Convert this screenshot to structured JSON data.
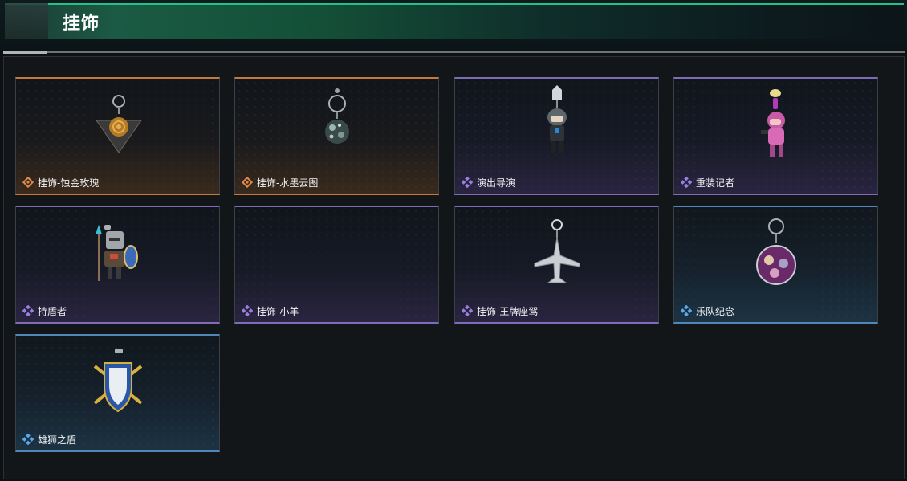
{
  "header": {
    "title": "挂饰"
  },
  "colors": {
    "gold": "#e08a4a",
    "purple": "#9a7ee0",
    "blue": "#5aa8e8",
    "accent_green": "#23c184"
  },
  "items": [
    {
      "label": "挂饰-蚀金玫瑰",
      "rarity": "gold",
      "icon": "rose-keychain-icon"
    },
    {
      "label": "挂饰-水墨云图",
      "rarity": "gold",
      "icon": "ball-keychain-icon"
    },
    {
      "label": "演出导演",
      "rarity": "purple",
      "icon": "soldier-figure-icon"
    },
    {
      "label": "重装记者",
      "rarity": "purple",
      "icon": "pink-figure-icon"
    },
    {
      "label": "持盾者",
      "rarity": "purple",
      "icon": "knight-figure-icon"
    },
    {
      "label": "挂饰-小羊",
      "rarity": "purple",
      "icon": "empty-icon"
    },
    {
      "label": "挂饰-王牌座驾",
      "rarity": "purple",
      "icon": "jet-keychain-icon"
    },
    {
      "label": "乐队纪念",
      "rarity": "blue",
      "icon": "badge-keychain-icon"
    },
    {
      "label": "雄狮之盾",
      "rarity": "blue",
      "icon": "lion-shield-icon"
    }
  ]
}
